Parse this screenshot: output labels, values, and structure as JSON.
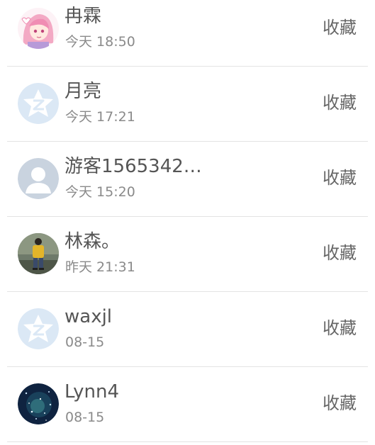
{
  "contacts": [
    {
      "name": "冉霖",
      "time": "今天 18:50",
      "action": "收藏",
      "avatar": "anime-avatar-icon"
    },
    {
      "name": "月亮",
      "time": "今天 17:21",
      "action": "收藏",
      "avatar": "qzone-star-avatar-icon"
    },
    {
      "name": "游客1565342…",
      "time": "今天 15:20",
      "action": "收藏",
      "avatar": "default-user-avatar-icon"
    },
    {
      "name": "林森。",
      "time": "昨天 21:31",
      "action": "收藏",
      "avatar": "photo-avatar-icon"
    },
    {
      "name": "waxjl",
      "time": "08-15",
      "action": "收藏",
      "avatar": "qzone-star-avatar-icon"
    },
    {
      "name": "Lynn4",
      "time": "08-15",
      "action": "收藏",
      "avatar": "night-sky-avatar-icon"
    }
  ],
  "colors": {
    "name_text": "#555555",
    "time_text": "#8a8a8a",
    "divider": "#e3e3e3",
    "qzone_avatar_bg": "#dbe8f5",
    "default_avatar_bg": "#c9d3df"
  }
}
